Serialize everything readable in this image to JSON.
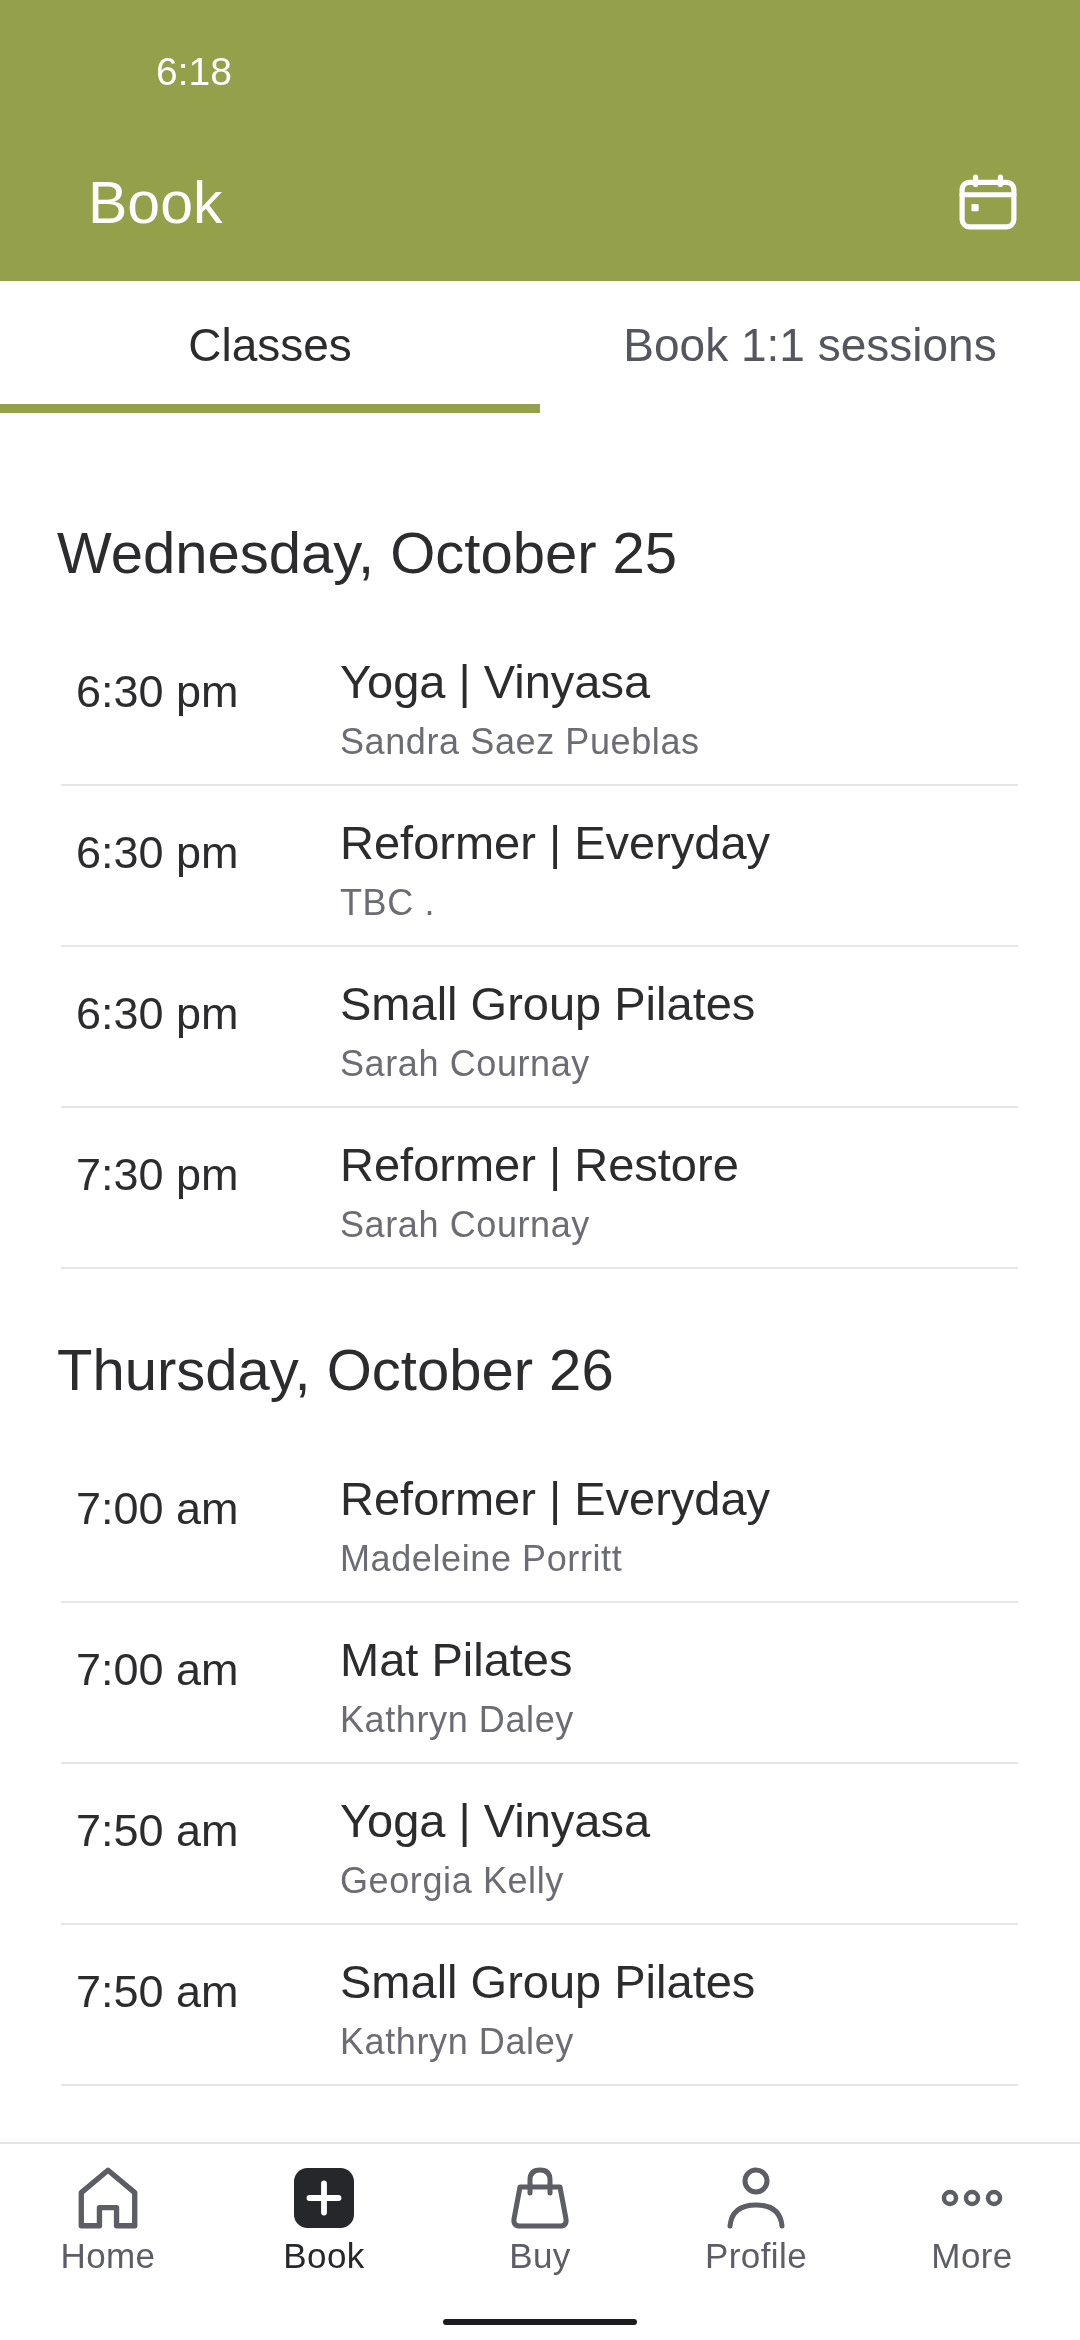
{
  "status_bar": {
    "time": "6:18"
  },
  "header": {
    "title": "Book"
  },
  "tabs": [
    {
      "label": "Classes",
      "selected": true
    },
    {
      "label": "Book 1:1 sessions",
      "selected": false
    }
  ],
  "days": [
    {
      "heading": "Wednesday, October 25",
      "classes": [
        {
          "time": "6:30 pm",
          "title": "Yoga | Vinyasa",
          "instructor": "Sandra Saez Pueblas"
        },
        {
          "time": "6:30 pm",
          "title": "Reformer | Everyday",
          "instructor": "TBC ."
        },
        {
          "time": "6:30 pm",
          "title": "Small Group Pilates",
          "instructor": "Sarah Cournay"
        },
        {
          "time": "7:30 pm",
          "title": "Reformer | Restore",
          "instructor": "Sarah Cournay"
        }
      ]
    },
    {
      "heading": "Thursday, October 26",
      "classes": [
        {
          "time": "7:00 am",
          "title": "Reformer | Everyday",
          "instructor": "Madeleine Porritt"
        },
        {
          "time": "7:00 am",
          "title": "Mat Pilates",
          "instructor": "Kathryn Daley"
        },
        {
          "time": "7:50 am",
          "title": "Yoga | Vinyasa",
          "instructor": "Georgia Kelly"
        },
        {
          "time": "7:50 am",
          "title": "Small Group Pilates",
          "instructor": "Kathryn Daley"
        }
      ]
    }
  ],
  "bottom_nav": [
    {
      "kind": "home",
      "label": "Home",
      "selected": false
    },
    {
      "kind": "book",
      "label": "Book",
      "selected": true
    },
    {
      "kind": "buy",
      "label": "Buy",
      "selected": false
    },
    {
      "kind": "profile",
      "label": "Profile",
      "selected": false
    },
    {
      "kind": "more",
      "label": "More",
      "selected": false
    }
  ]
}
